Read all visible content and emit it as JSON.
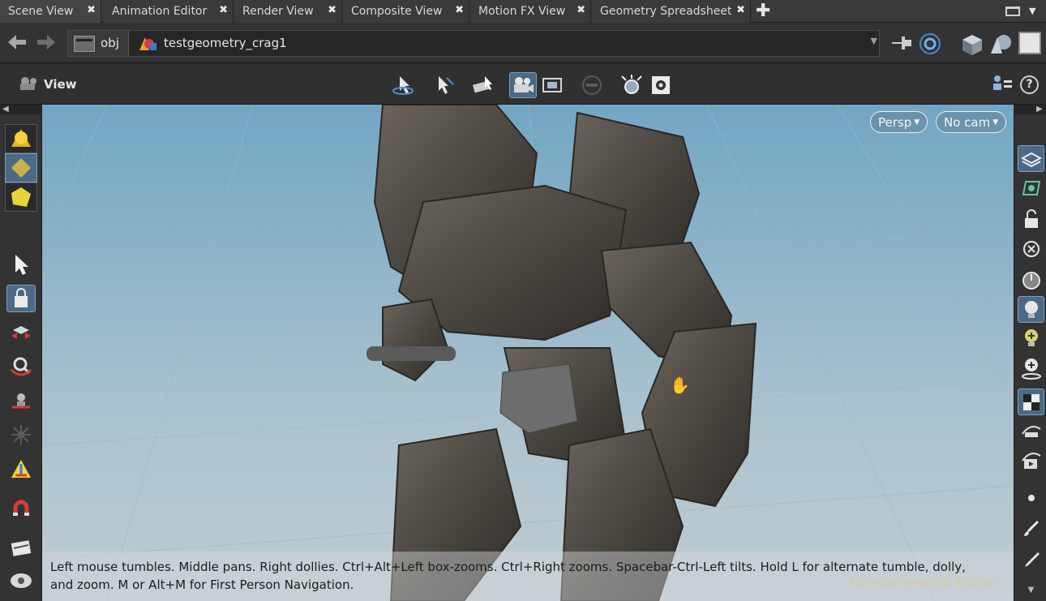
{
  "tabs": [
    {
      "label": "Scene View",
      "active": true
    },
    {
      "label": "Animation Editor",
      "active": false
    },
    {
      "label": "Render View",
      "active": false
    },
    {
      "label": "Composite View",
      "active": false
    },
    {
      "label": "Motion FX View",
      "active": false
    },
    {
      "label": "Geometry Spreadsheet",
      "active": false
    }
  ],
  "tab_close_glyph": "✖",
  "tab_add_glyph": "✚",
  "path": {
    "crumbs": [
      "obj",
      "testgeometry_crag1"
    ]
  },
  "viewer": {
    "title": "View",
    "perspective_label": "Persp",
    "camera_label": "No cam",
    "help_label": "?"
  },
  "status": {
    "hint": "Left mouse tumbles. Middle pans. Right dollies. Ctrl+Alt+Left box-zooms. Ctrl+Right zooms. Spacebar-Ctrl-Left tilts. Hold L for alternate tumble, dolly, and zoom.     M or Alt+M for First Person Navigation.",
    "watermark": "Non-Commercial Edition"
  },
  "icons": {
    "back": "arrow-left-icon",
    "forward": "arrow-right-icon",
    "pin": "pin-icon",
    "cursor": "hand-cursor-icon"
  },
  "colors": {
    "accent": "#4c6a86",
    "sky_top": "#72a6c3",
    "sky_bottom": "#c1ccd1",
    "rock": "#4a4640"
  }
}
